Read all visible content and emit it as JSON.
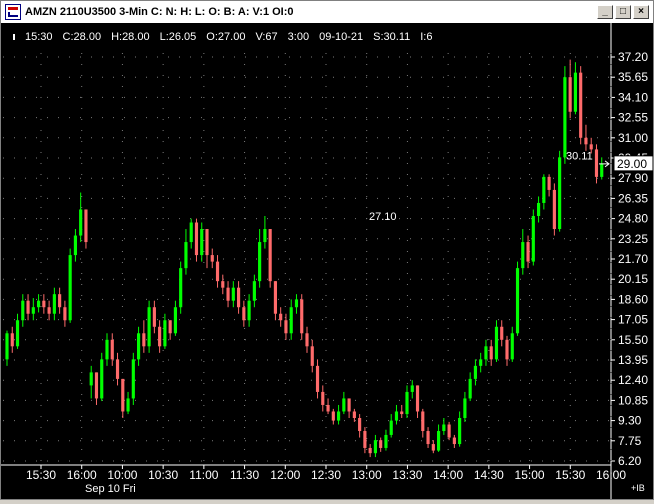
{
  "window": {
    "title": "AMZN 2110U3500 3-Min C: N: H: L: O: B: A: V:1 OI:0",
    "buttons": [
      "_",
      "□",
      "×"
    ]
  },
  "infobar": {
    "time": "15:30",
    "close": "C:28.00",
    "high": "H:28.00",
    "low": "L:26.05",
    "open": "O:27.00",
    "volume": "V:67",
    "interval": "3:00",
    "date": "09-10-21",
    "strike": "S:30.11",
    "index": "I:6"
  },
  "annotations": {
    "mid_label": "27.10",
    "last_label": "30.11",
    "current_price": "29.00"
  },
  "footer": {
    "date_label": "Sep 10 Fri",
    "corner_label": "+IB"
  },
  "colors": {
    "background": "#000000",
    "up": "#00ff00",
    "down": "#ff6b6b",
    "grid": "#7a7a7a",
    "axis_text": "#ffffff"
  },
  "chart_data": {
    "type": "candlestick",
    "y_ticks": [
      "37.20",
      "35.65",
      "34.10",
      "32.55",
      "31.00",
      "29.45",
      "27.90",
      "26.35",
      "24.80",
      "23.25",
      "21.70",
      "20.15",
      "18.60",
      "17.05",
      "15.50",
      "13.95",
      "12.40",
      "10.85",
      "9.30",
      "7.75",
      "6.20"
    ],
    "x_ticks": [
      "15:30",
      "16:00",
      "10:00",
      "10:30",
      "11:00",
      "11:30",
      "12:00",
      "12:30",
      "13:00",
      "13:30",
      "14:00",
      "14:30",
      "15:00",
      "15:30",
      "16:00"
    ],
    "ylim": [
      6.2,
      37.2
    ],
    "candles": [
      [
        14,
        16,
        13.5,
        16.2
      ],
      [
        16,
        15,
        14.5,
        16.5
      ],
      [
        15,
        17,
        14.8,
        17.5
      ],
      [
        17,
        18.5,
        16.5,
        19
      ],
      [
        18.5,
        17.5,
        17,
        19
      ],
      [
        17.5,
        18,
        17,
        18.7
      ],
      [
        18,
        18.5,
        17.6,
        19
      ],
      [
        18.5,
        18,
        17.5,
        19
      ],
      [
        18,
        17.5,
        17,
        18.5
      ],
      [
        17.5,
        19,
        17,
        19.5
      ],
      [
        19,
        18,
        17.5,
        19.5
      ],
      [
        18,
        17,
        16.5,
        18.5
      ],
      [
        17,
        22,
        16.8,
        22.5
      ],
      [
        22,
        23.5,
        21.5,
        24
      ],
      [
        23.5,
        25.5,
        23,
        26.8
      ],
      [
        25.5,
        23,
        22.5,
        25.5
      ],
      [
        12,
        13,
        11,
        13.5
      ],
      [
        13,
        11,
        10.5,
        13
      ],
      [
        11,
        14,
        10.8,
        14.5
      ],
      [
        14,
        15.5,
        13.5,
        16
      ],
      [
        15.5,
        14,
        13.5,
        16
      ],
      [
        14,
        12.5,
        12,
        14.5
      ],
      [
        12.5,
        10,
        9.5,
        12.5
      ],
      [
        10,
        11,
        9.8,
        11.5
      ],
      [
        11,
        14,
        10.5,
        14.5
      ],
      [
        14,
        16,
        13.5,
        16.5
      ],
      [
        16,
        15,
        14.5,
        17
      ],
      [
        15,
        18,
        14.5,
        18.5
      ],
      [
        18,
        16.5,
        16,
        18.5
      ],
      [
        16.5,
        15,
        14.5,
        17
      ],
      [
        15,
        17,
        14.8,
        17.5
      ],
      [
        17,
        16,
        15.5,
        17
      ],
      [
        16,
        18,
        15.8,
        18.5
      ],
      [
        18,
        21,
        17.5,
        21.5
      ],
      [
        21,
        23,
        20.5,
        24
      ],
      [
        23,
        24.5,
        22.5,
        24.8
      ],
      [
        24.5,
        22,
        21.5,
        24.8
      ],
      [
        22,
        24,
        21.5,
        24.5
      ],
      [
        24,
        22,
        21,
        24
      ],
      [
        22,
        21.5,
        21,
        22.5
      ],
      [
        21.5,
        20,
        19.5,
        22
      ],
      [
        20,
        19.5,
        19,
        20.5
      ],
      [
        19.5,
        18.5,
        18,
        20
      ],
      [
        18.5,
        19.5,
        18,
        20
      ],
      [
        19.5,
        18,
        17.5,
        20
      ],
      [
        18,
        17,
        16.5,
        18.5
      ],
      [
        17,
        18.5,
        16.5,
        19
      ],
      [
        18.5,
        20,
        18,
        20.5
      ],
      [
        20,
        23,
        19.5,
        24
      ],
      [
        23,
        24,
        22.5,
        25
      ],
      [
        24,
        20,
        19.5,
        24
      ],
      [
        20,
        17.5,
        17,
        20
      ],
      [
        17.5,
        17,
        16.5,
        18
      ],
      [
        17,
        16,
        15.5,
        17.5
      ],
      [
        16,
        18,
        15.5,
        18.6
      ],
      [
        18,
        18.6,
        17.5,
        19
      ],
      [
        18.6,
        16,
        15.5,
        19
      ],
      [
        16,
        15,
        14.5,
        16.5
      ],
      [
        15,
        13.5,
        13,
        15.5
      ],
      [
        13.5,
        11.5,
        11,
        14
      ],
      [
        11.5,
        10.5,
        10,
        12
      ],
      [
        10.5,
        10,
        9.8,
        11
      ],
      [
        10,
        9.3,
        9,
        10.2
      ],
      [
        9.3,
        10,
        9,
        10.5
      ],
      [
        10,
        11,
        9.8,
        11.5
      ],
      [
        11,
        10,
        9.5,
        11
      ],
      [
        10,
        9.5,
        9.2,
        10.2
      ],
      [
        9.5,
        8.5,
        8,
        9.8
      ],
      [
        8.5,
        7.2,
        6.8,
        8.8
      ],
      [
        7.2,
        6.8,
        6.5,
        7.5
      ],
      [
        6.8,
        7.8,
        6.5,
        8.2
      ],
      [
        7.8,
        7.2,
        6.9,
        8
      ],
      [
        7.2,
        8.2,
        7,
        8.6
      ],
      [
        8.2,
        9.3,
        8,
        9.8
      ],
      [
        9.3,
        10,
        9,
        10.5
      ],
      [
        10,
        9.8,
        9.5,
        10.5
      ],
      [
        9.8,
        11.5,
        9.5,
        12
      ],
      [
        11.5,
        12,
        11,
        12.4
      ],
      [
        12,
        10,
        9.5,
        12
      ],
      [
        10,
        8.5,
        8,
        10.2
      ],
      [
        8.5,
        7.5,
        7.2,
        8.8
      ],
      [
        7.5,
        7,
        6.8,
        7.8
      ],
      [
        7,
        8.5,
        6.9,
        9
      ],
      [
        8.5,
        9,
        8.2,
        9.5
      ],
      [
        9,
        8,
        7.8,
        9.2
      ],
      [
        8,
        7.5,
        7.2,
        8.2
      ],
      [
        7.5,
        9.5,
        7.3,
        10
      ],
      [
        9.5,
        11,
        9.2,
        11.5
      ],
      [
        11,
        12.5,
        10.8,
        13
      ],
      [
        12.5,
        13.5,
        12,
        14
      ],
      [
        13.5,
        14,
        13,
        14.5
      ],
      [
        14,
        15,
        13.5,
        15.5
      ],
      [
        15,
        14,
        13.5,
        15.5
      ],
      [
        14,
        16.5,
        13.8,
        17
      ],
      [
        16.5,
        15.5,
        15,
        17
      ],
      [
        15.5,
        14,
        13.5,
        15.8
      ],
      [
        14,
        16,
        13.8,
        16.5
      ],
      [
        16,
        21,
        15.8,
        21.5
      ],
      [
        21,
        23,
        20.5,
        24
      ],
      [
        23,
        21.5,
        21,
        23.5
      ],
      [
        21.5,
        25,
        21.2,
        25.5
      ],
      [
        25,
        26,
        24.5,
        26.5
      ],
      [
        26,
        28,
        25.5,
        28.2
      ],
      [
        28,
        27,
        26.5,
        28.2
      ],
      [
        27,
        24,
        23.5,
        27.5
      ],
      [
        24,
        29.5,
        23.8,
        30
      ],
      [
        29.5,
        35.65,
        29,
        36.5
      ],
      [
        35.65,
        33,
        32.5,
        37
      ],
      [
        33,
        36,
        32.8,
        36.8
      ],
      [
        36,
        31,
        30.5,
        36.5
      ],
      [
        31,
        30.5,
        30,
        32
      ],
      [
        30.5,
        30.11,
        29.8,
        31
      ],
      [
        30.11,
        28,
        27.5,
        30.5
      ],
      [
        28,
        29,
        27.8,
        29.5
      ]
    ]
  }
}
